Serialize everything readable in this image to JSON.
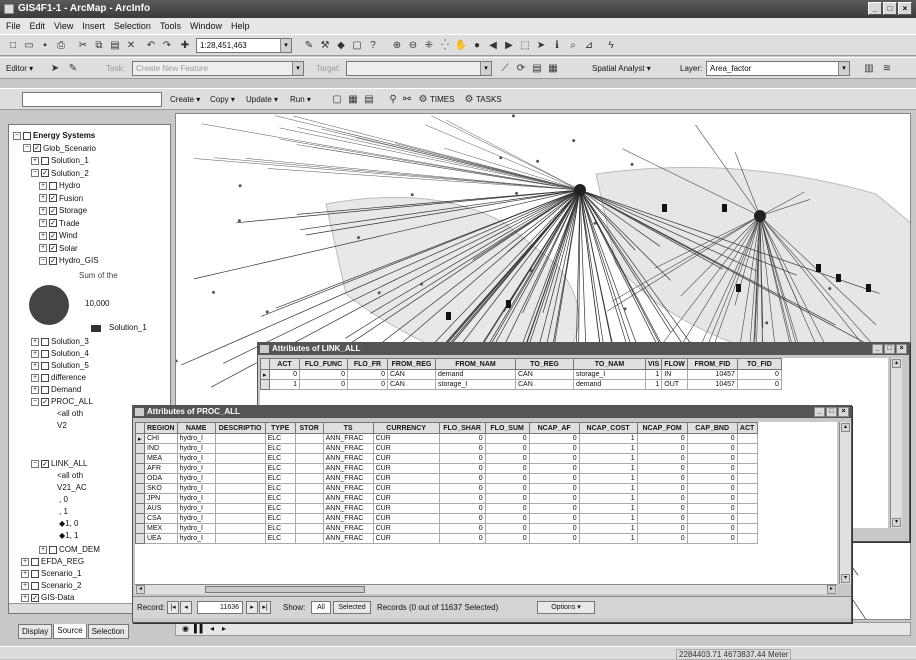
{
  "window": {
    "title": "GIS4F1-1 - ArcMap - ArcInfo",
    "buttons": [
      "_",
      "□",
      "×"
    ]
  },
  "menu": [
    "File",
    "Edit",
    "View",
    "Insert",
    "Selection",
    "Tools",
    "Window",
    "Help"
  ],
  "toolbar1": {
    "scale": "1:28,451,463"
  },
  "toolbar2": {
    "editor": "Editor ▾",
    "task_label": "Task:",
    "task_value": "Create New Feature",
    "target_label": "Target:",
    "spatial_analyst": "Spatial Analyst ▾",
    "layer_label": "Layer:",
    "layer_value": "Area_factor"
  },
  "toolbar3": {
    "items": [
      "Create ▾",
      "Copy ▾",
      "Update ▾",
      "Run ▾"
    ],
    "tabs": [
      "TIMES",
      "TASKS"
    ]
  },
  "toc": {
    "items": [
      {
        "label": "Energy Systems",
        "pm": "−",
        "cb": "",
        "bold": true
      },
      {
        "label": "Glob_Scenario",
        "pm": "−",
        "cb": "✓"
      },
      {
        "label": "Solution_1",
        "pm": "+",
        "cb": ""
      },
      {
        "label": "Solution_2",
        "pm": "−",
        "cb": "✓"
      },
      {
        "label": "Hydro",
        "pm": "+",
        "cb": ""
      },
      {
        "label": "Fusion",
        "pm": "+",
        "cb": "✓"
      },
      {
        "label": "Storage",
        "pm": "+",
        "cb": "✓"
      },
      {
        "label": "Trade",
        "pm": "+",
        "cb": "✓"
      },
      {
        "label": "Wind",
        "pm": "+",
        "cb": "✓"
      },
      {
        "label": "Solar",
        "pm": "+",
        "cb": "✓"
      },
      {
        "label": "Hydro_GIS",
        "pm": "−",
        "cb": "✓"
      }
    ],
    "sum_label": "Sum of the",
    "legend_value": "10,000",
    "solution_legend": "Solution_1",
    "items2": [
      {
        "label": "Solution_3",
        "pm": "+",
        "cb": ""
      },
      {
        "label": "Solution_4",
        "pm": "+",
        "cb": ""
      },
      {
        "label": "Solution_5",
        "pm": "+",
        "cb": ""
      },
      {
        "label": "difference",
        "pm": "+",
        "cb": ""
      },
      {
        "label": "Demand",
        "pm": "+",
        "cb": ""
      },
      {
        "label": "PROC_ALL",
        "pm": "−",
        "cb": "✓"
      }
    ],
    "proc_sub": [
      "<all oth",
      "V2"
    ],
    "link_label": "LINK_ALL",
    "link_sub": [
      "<all oth",
      "V21_AC"
    ],
    "link_vals": [
      ", 0",
      ", 1",
      "1, 0",
      "1, 1"
    ],
    "items3": [
      {
        "label": "COM_DEM",
        "pm": "+",
        "cb": ""
      },
      {
        "label": "EFDA_REG",
        "pm": "+",
        "cb": ""
      },
      {
        "label": "Scenario_1",
        "pm": "+",
        "cb": ""
      },
      {
        "label": "Scenario_2",
        "pm": "+",
        "cb": ""
      },
      {
        "label": "GIS-Data",
        "pm": "+",
        "cb": "✓"
      }
    ],
    "tabs": [
      "Display",
      "Source",
      "Selection"
    ]
  },
  "link_table": {
    "title": "Attributes of LINK_ALL",
    "columns": [
      "ACT",
      "FLO_FUNC",
      "FLO_FR",
      "FROM_REG",
      "FROM_NAM",
      "TO_REG",
      "TO_NAM",
      "VIS",
      "FLOW",
      "FROM_FID",
      "TO_FID"
    ],
    "rows": [
      [
        "0",
        "0",
        "0",
        "CAN",
        "demand",
        "CAN",
        "storage_I",
        "1",
        "IN",
        "10457",
        "0"
      ],
      [
        "1",
        "0",
        "0",
        "CAN",
        "storage_I",
        "CAN",
        "demand",
        "1",
        "OUT",
        "10457",
        "0"
      ]
    ]
  },
  "proc_table": {
    "title": "Attributes of PROC_ALL",
    "columns": [
      "REGION",
      "NAME",
      "DESCRIPTIO",
      "TYPE",
      "STOR",
      "TS",
      "CURRENCY",
      "FLO_SHAR",
      "FLO_SUM",
      "NCAP_AF",
      "NCAP_COST",
      "NCAP_FOM",
      "CAP_BND",
      "ACT"
    ],
    "rows": [
      [
        "CHI",
        "hydro_I",
        "",
        "ELC",
        "",
        "ANN_FRAC",
        "CUR",
        "0",
        "0",
        "0",
        "1",
        "0",
        "0",
        ""
      ],
      [
        "IND",
        "hydro_I",
        "",
        "ELC",
        "",
        "ANN_FRAC",
        "CUR",
        "0",
        "0",
        "0",
        "1",
        "0",
        "0",
        ""
      ],
      [
        "MEA",
        "hydro_I",
        "",
        "ELC",
        "",
        "ANN_FRAC",
        "CUR",
        "0",
        "0",
        "0",
        "1",
        "0",
        "0",
        ""
      ],
      [
        "AFR",
        "hydro_I",
        "",
        "ELC",
        "",
        "ANN_FRAC",
        "CUR",
        "0",
        "0",
        "0",
        "1",
        "0",
        "0",
        ""
      ],
      [
        "ODA",
        "hydro_I",
        "",
        "ELC",
        "",
        "ANN_FRAC",
        "CUR",
        "0",
        "0",
        "0",
        "1",
        "0",
        "0",
        ""
      ],
      [
        "SKO",
        "hydro_I",
        "",
        "ELC",
        "",
        "ANN_FRAC",
        "CUR",
        "0",
        "0",
        "0",
        "1",
        "0",
        "0",
        ""
      ],
      [
        "JPN",
        "hydro_I",
        "",
        "ELC",
        "",
        "ANN_FRAC",
        "CUR",
        "0",
        "0",
        "0",
        "1",
        "0",
        "0",
        ""
      ],
      [
        "AUS",
        "hydro_I",
        "",
        "ELC",
        "",
        "ANN_FRAC",
        "CUR",
        "0",
        "0",
        "0",
        "1",
        "0",
        "0",
        ""
      ],
      [
        "CSA",
        "hydro_I",
        "",
        "ELC",
        "",
        "ANN_FRAC",
        "CUR",
        "0",
        "0",
        "0",
        "1",
        "0",
        "0",
        ""
      ],
      [
        "MEX",
        "hydro_I",
        "",
        "ELC",
        "",
        "ANN_FRAC",
        "CUR",
        "0",
        "0",
        "0",
        "1",
        "0",
        "0",
        ""
      ],
      [
        "UEA",
        "hydro_I",
        "",
        "ELC",
        "",
        "ANN_FRAC",
        "CUR",
        "0",
        "0",
        "0",
        "1",
        "0",
        "0",
        ""
      ]
    ],
    "record_label": "Record:",
    "record_value": "11636",
    "show_label": "Show:",
    "show_all": "All",
    "show_selected": "Selected",
    "records_text": "Records (0 out of 11637 Selected)",
    "options": "Options ▾"
  },
  "status": {
    "coords": "2284403.71  4673837.44 Meter"
  },
  "colors": {
    "title_bg": "#444444",
    "chrome": "#dcdcdc",
    "map_bg": "#ffffff",
    "cluster": "#222222"
  }
}
